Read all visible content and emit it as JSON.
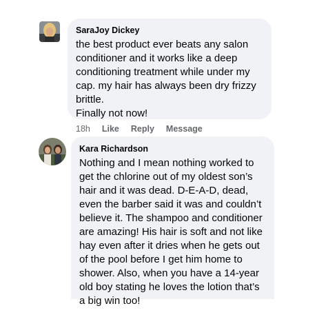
{
  "comments": [
    {
      "author": "SaraJoy Dickey",
      "text": "the best product ever beats any salon\nconditioner and it works like a deep\nconditioning treatment while under my\ncap. my hair has always been dry frizzy\nbrittle.\nFinally not now!",
      "time": "18h",
      "like_label": "Like",
      "reply_label": "Reply",
      "message_label": "Message"
    },
    {
      "author": "Kara Richardson",
      "text": "Nothing and I mean nothing worked to\nget the chlorine out of my oldest son’s\nhair and it was dead. D-E-A-D, dead,\neven the barber said it was and couldn’t\nbelieve it. The shampoo and conditioner\nare amazing! His hair is soft and not like\nhay even after it dries when he gets out\nof the pool before I get him home to\nshower. Also, when you have a 14-year\nold boy stating he loves the lotion that’s\na big win too!"
    }
  ]
}
